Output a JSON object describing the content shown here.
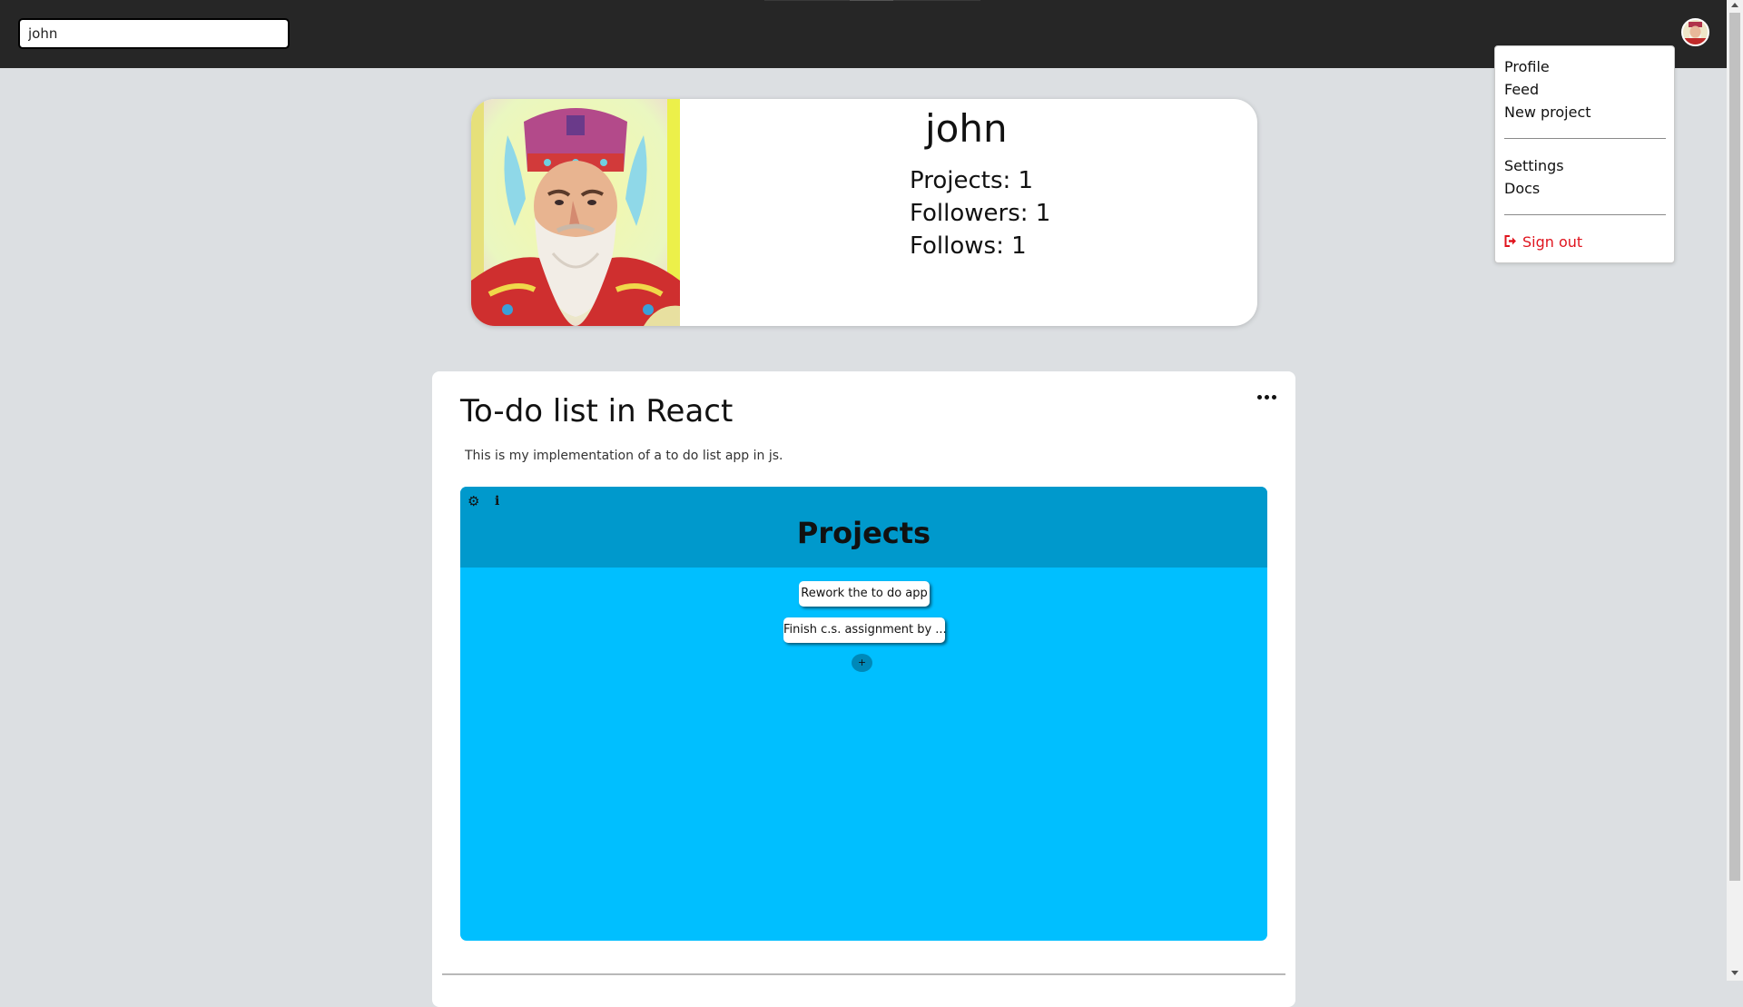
{
  "search": {
    "value": "john"
  },
  "dropdown": {
    "items": [
      "Profile",
      "Feed",
      "New project",
      "Settings",
      "Docs"
    ],
    "sign_out": "Sign out"
  },
  "profile": {
    "name": "john",
    "projects": "Projects: 1",
    "followers": "Followers: 1",
    "follows": "Follows: 1"
  },
  "project": {
    "title": "To-do list in React",
    "description": "This is my implementation of a to do list app in js.",
    "embed": {
      "title": "Projects",
      "items": [
        "Rework the to do app",
        "Finish c.s. assignment by ..."
      ],
      "add_label": "+"
    }
  },
  "colors": {
    "topbar": "#262626",
    "page_bg": "#dcdfe2",
    "embed_header": "#0099cc",
    "embed_body": "#00bfff",
    "sign_out": "#e0141e"
  },
  "icons": [
    "gear-icon",
    "info-icon",
    "more-icon",
    "sign-out-icon",
    "avatar"
  ]
}
